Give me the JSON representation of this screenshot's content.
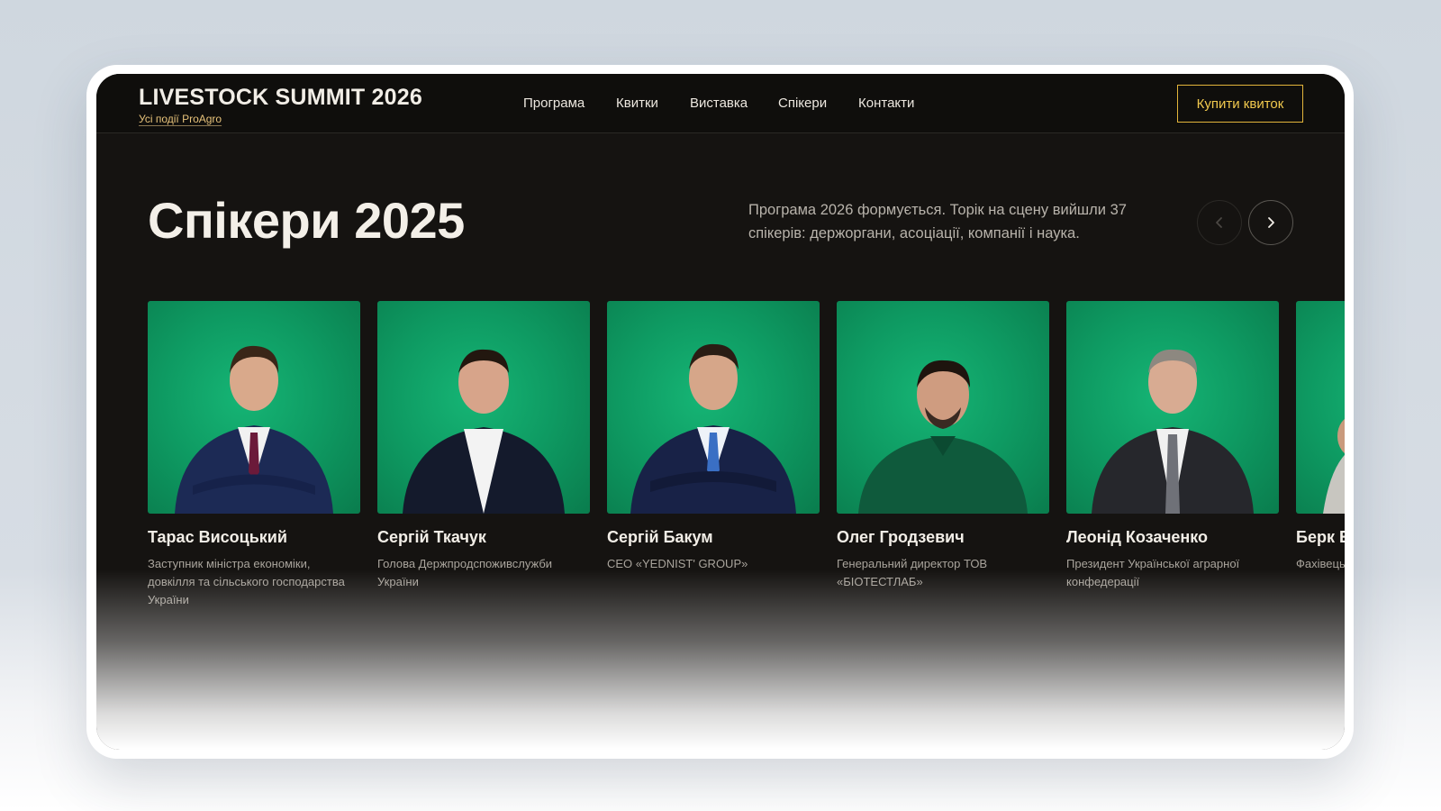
{
  "header": {
    "logo_title": "LIVESTOCK SUMMIT 2026",
    "logo_sub": "Усі події ProAgro",
    "nav": [
      "Програма",
      "Квитки",
      "Виставка",
      "Спікери",
      "Контакти"
    ],
    "buy_label": "Купити квиток"
  },
  "section": {
    "title": "Спікери 2025",
    "description": "Програма 2026 формується. Торік на сцену вийшли 37 спікерів: держоргани, асоціації, компанії і наука."
  },
  "speakers": [
    {
      "name": "Тарас Висоцький",
      "role": "Заступник міністра економіки, довкілля та сільського господарства України"
    },
    {
      "name": "Сергій Ткачук",
      "role": "Голова Держпродспоживслужби України"
    },
    {
      "name": "Сергій Бакум",
      "role": "CEO «YEDNIST' GROUP»"
    },
    {
      "name": "Олег Гродзевич",
      "role": "Генеральний директор ТОВ «БІОТЕСТЛАБ»"
    },
    {
      "name": "Леонід Козаченко",
      "role": "Президент Української аграрної конфедерації"
    },
    {
      "name": "Берк Е",
      "role": "Фахівець «KUTLUS"
    }
  ],
  "colors": {
    "accent": "#e2b43a",
    "background": "#151311",
    "photo_bg": "#0e9a62"
  },
  "icons": {
    "prev": "chevron-left-icon",
    "next": "chevron-right-icon"
  }
}
